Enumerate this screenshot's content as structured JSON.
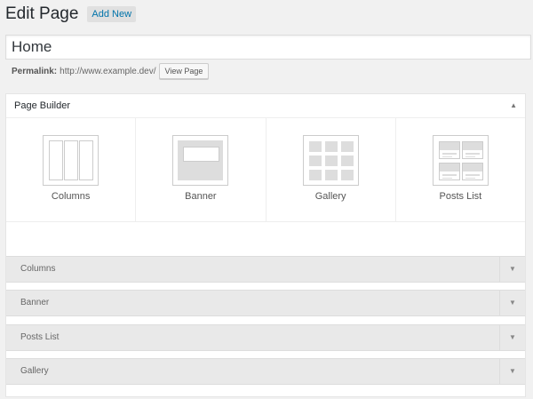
{
  "header": {
    "title": "Edit Page",
    "add_new": "Add New"
  },
  "title_field": {
    "value": "Home"
  },
  "permalink": {
    "label": "Permalink:",
    "url": "http://www.example.dev/",
    "view_button": "View Page"
  },
  "page_builder": {
    "title": "Page Builder",
    "toggle_icon": "triangle-up",
    "modules": [
      {
        "label": "Columns",
        "icon": "columns-icon"
      },
      {
        "label": "Banner",
        "icon": "banner-icon"
      },
      {
        "label": "Gallery",
        "icon": "gallery-icon"
      },
      {
        "label": "Posts List",
        "icon": "posts-list-icon"
      }
    ],
    "rows": [
      {
        "label": "Columns"
      },
      {
        "label": "Banner"
      },
      {
        "label": "Posts List"
      },
      {
        "label": "Gallery"
      }
    ]
  },
  "colors": {
    "link": "#0073aa",
    "background": "#f1f1f1",
    "panel": "#ffffff",
    "row": "#e9e9e9"
  }
}
